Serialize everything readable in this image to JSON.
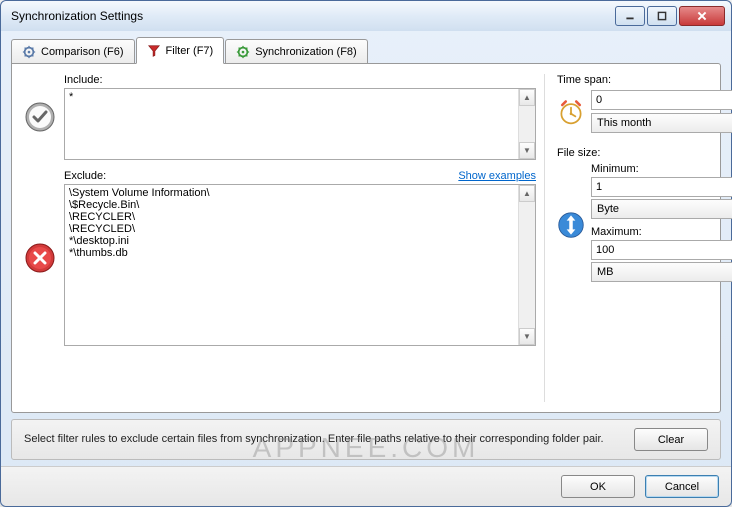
{
  "window": {
    "title": "Synchronization Settings"
  },
  "tabs": [
    {
      "label": "Comparison (F6)"
    },
    {
      "label": "Filter (F7)"
    },
    {
      "label": "Synchronization (F8)"
    }
  ],
  "include": {
    "label": "Include:",
    "value": "*"
  },
  "exclude": {
    "label": "Exclude:",
    "show_examples": "Show examples",
    "value": "\\System Volume Information\\\n\\$Recycle.Bin\\\n\\RECYCLER\\\n\\RECYCLED\\\n*\\desktop.ini\n*\\thumbs.db"
  },
  "timespan": {
    "label": "Time span:",
    "value": "0",
    "unit": "This month"
  },
  "filesize": {
    "label": "File size:",
    "min_label": "Minimum:",
    "min_value": "1",
    "min_unit": "Byte",
    "max_label": "Maximum:",
    "max_value": "100",
    "max_unit": "MB"
  },
  "footer": {
    "text": "Select filter rules to exclude certain files from synchronization. Enter file paths relative to their corresponding folder pair.",
    "clear": "Clear",
    "ok": "OK",
    "cancel": "Cancel"
  },
  "watermark": "APPNEE.COM"
}
